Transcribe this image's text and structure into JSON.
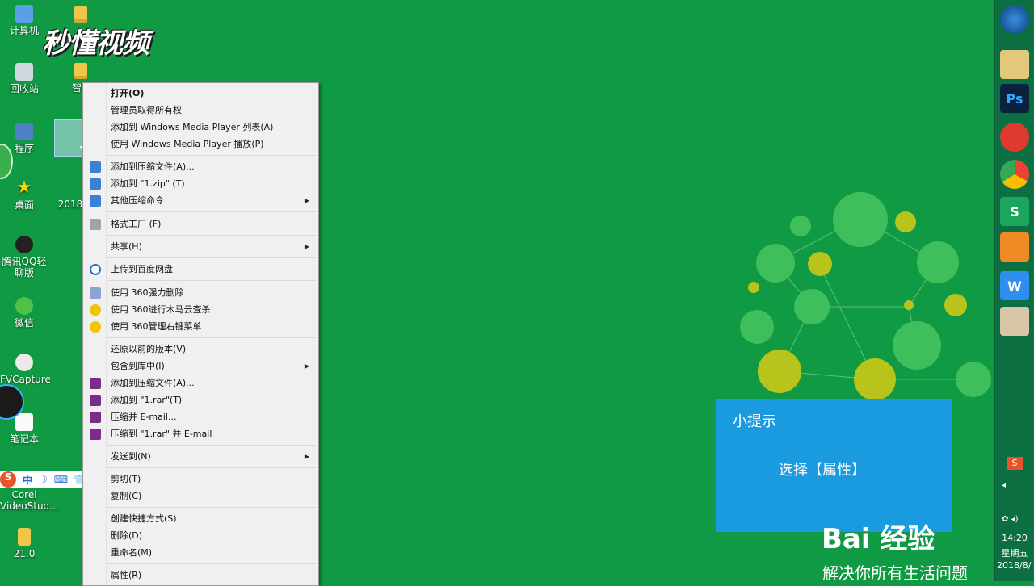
{
  "desktop": {
    "icons": [
      {
        "label": "计算机"
      },
      {
        "label": "回收站"
      },
      {
        "label": "程序"
      },
      {
        "label": "桌面"
      },
      {
        "label": "腾讯QQ轻聊版"
      },
      {
        "label": "微信"
      },
      {
        "label": "FVCapture"
      },
      {
        "label": "笔记本"
      },
      {
        "label": "Corel VideoStud..."
      },
      {
        "label": "21.0"
      },
      {
        "label": "2018"
      },
      {
        "label": "智"
      }
    ],
    "watermark_logo": "秒懂视频"
  },
  "ime_bar": {
    "items": [
      "S",
      "中",
      "☽",
      "⌨",
      "👕",
      "🔧"
    ]
  },
  "context_menu": {
    "items": [
      {
        "label": "打开(O)"
      },
      {
        "label": "管理员取得所有权"
      },
      {
        "label": "添加到 Windows Media Player 列表(A)"
      },
      {
        "label": "使用 Windows Media Player 播放(P)"
      },
      {
        "label": "添加到压缩文件(A)..."
      },
      {
        "label": "添加到 \"1.zip\" (T)"
      },
      {
        "label": "其他压缩命令"
      },
      {
        "label": "格式工厂 (F)"
      },
      {
        "label": "共享(H)"
      },
      {
        "label": "上传到百度网盘"
      },
      {
        "label": "使用 360强力删除"
      },
      {
        "label": "使用 360进行木马云查杀"
      },
      {
        "label": "使用 360管理右键菜单"
      },
      {
        "label": "还原以前的版本(V)"
      },
      {
        "label": "包含到库中(I)"
      },
      {
        "label": "添加到压缩文件(A)..."
      },
      {
        "label": "添加到 \"1.rar\"(T)"
      },
      {
        "label": "压缩并 E-mail..."
      },
      {
        "label": "压缩到 \"1.rar\" 并 E-mail"
      },
      {
        "label": "发送到(N)"
      },
      {
        "label": "剪切(T)"
      },
      {
        "label": "复制(C)"
      },
      {
        "label": "创建快捷方式(S)"
      },
      {
        "label": "删除(D)"
      },
      {
        "label": "重命名(M)"
      },
      {
        "label": "属性(R)"
      }
    ]
  },
  "tip": {
    "title": "小提示",
    "body": "选择【属性】"
  },
  "brand": {
    "name": "Bai 经验",
    "slogan": "解决你所有生活问题"
  },
  "taskbar": {
    "apps": [
      "start",
      "explorer",
      "Ps",
      "netease-music",
      "chrome",
      "S",
      "uc",
      "W",
      "avatar"
    ],
    "tray_icon": "S",
    "time": "14:20",
    "weekday": "星期五",
    "date": "2018/8/"
  },
  "colors": {
    "desktop": "#0f9a43",
    "tip_bg": "#1a9be0",
    "menu_bg": "#f0f0f0",
    "taskbar": "#0c6f42"
  }
}
